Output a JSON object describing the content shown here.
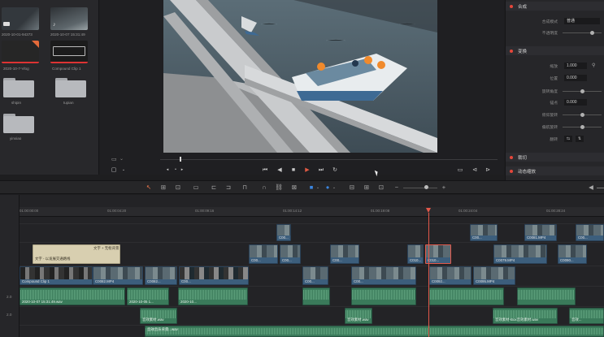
{
  "media_pool": {
    "clips": [
      {
        "label": "2020-10-01-94373"
      },
      {
        "label": "2020-10-07 15:31:49"
      },
      {
        "label": "2020-10-7-Vlog"
      },
      {
        "label": "Compound Clip 1"
      }
    ],
    "folders": [
      {
        "label": "shipin"
      },
      {
        "label": "tupian"
      },
      {
        "label": "yinxiao"
      }
    ]
  },
  "inspector": {
    "sections": {
      "composite": "合成",
      "transform": "变换",
      "cropping": "裁切",
      "dynamic_zoom": "动态缩放"
    },
    "composite_mode_label": "合成模式",
    "composite_mode_value": "普通",
    "opacity_label": "不透明度",
    "zoom_label": "缩放",
    "zoom_value": "1.000",
    "position_label": "位置",
    "position_value": "0.000",
    "rotation_label": "旋转角度",
    "anchor_label": "锚点",
    "anchor_value": "0.000",
    "pitch_label": "俯仰旋转",
    "yaw_label": "偏航旋转",
    "flip_label": "翻转"
  },
  "timeline": {
    "ruler_ticks": [
      "01:00:00:00",
      "01:00:04:20",
      "01:00:09:16",
      "01:00:14:12",
      "01:00:19:08",
      "01:00:24:04",
      "01:00:28:24",
      "01:00:33:20"
    ],
    "video_clips": {
      "v4": [
        "C00...",
        "C00..."
      ],
      "v3": [
        "C00...",
        "C00...",
        "C00...",
        "C0081.MP4",
        "C00..."
      ],
      "v2": [
        "C00...",
        "C00...",
        "C00...",
        "C00...",
        "C0079.MP4",
        "C0090..."
      ],
      "v1": [
        "Compound Clip 1",
        "C0082.MP4",
        "C0082...",
        "C00...",
        "C00...",
        "C0092...",
        "C0095.MP4",
        "C009..."
      ]
    },
    "title_clip": {
      "top": "文字 + 无框背景",
      "bottom": "文字 - 以发展交通路线"
    },
    "audio_clips": {
      "a1": [
        "2020-10-07 15:31:49.wav",
        "2020-10-05 1...",
        "2020-10..."
      ],
      "a2": [
        "音效素材.wav",
        "音效素材.wav",
        "音效素材-Box音效素材.wav",
        "音效..."
      ],
      "a3": [
        "音效音乐背景...wav"
      ]
    },
    "track_labels": [
      "2.0",
      "2.0"
    ]
  }
}
